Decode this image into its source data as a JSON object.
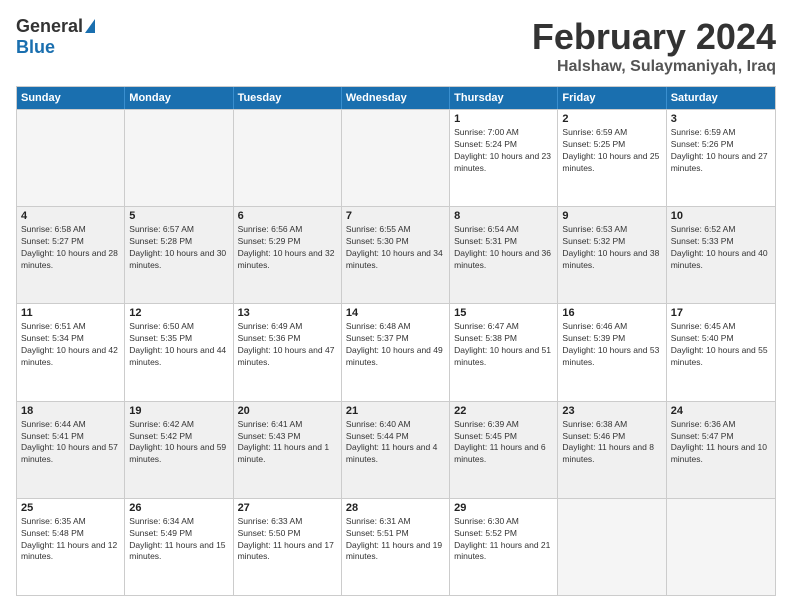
{
  "header": {
    "logo_general": "General",
    "logo_blue": "Blue",
    "month_title": "February 2024",
    "location": "Halshaw, Sulaymaniyah, Iraq"
  },
  "weekdays": [
    "Sunday",
    "Monday",
    "Tuesday",
    "Wednesday",
    "Thursday",
    "Friday",
    "Saturday"
  ],
  "rows": [
    [
      {
        "day": "",
        "empty": true
      },
      {
        "day": "",
        "empty": true
      },
      {
        "day": "",
        "empty": true
      },
      {
        "day": "",
        "empty": true
      },
      {
        "day": "1",
        "sunrise": "7:00 AM",
        "sunset": "5:24 PM",
        "daylight": "10 hours and 23 minutes."
      },
      {
        "day": "2",
        "sunrise": "6:59 AM",
        "sunset": "5:25 PM",
        "daylight": "10 hours and 25 minutes."
      },
      {
        "day": "3",
        "sunrise": "6:59 AM",
        "sunset": "5:26 PM",
        "daylight": "10 hours and 27 minutes."
      }
    ],
    [
      {
        "day": "4",
        "sunrise": "6:58 AM",
        "sunset": "5:27 PM",
        "daylight": "10 hours and 28 minutes."
      },
      {
        "day": "5",
        "sunrise": "6:57 AM",
        "sunset": "5:28 PM",
        "daylight": "10 hours and 30 minutes."
      },
      {
        "day": "6",
        "sunrise": "6:56 AM",
        "sunset": "5:29 PM",
        "daylight": "10 hours and 32 minutes."
      },
      {
        "day": "7",
        "sunrise": "6:55 AM",
        "sunset": "5:30 PM",
        "daylight": "10 hours and 34 minutes."
      },
      {
        "day": "8",
        "sunrise": "6:54 AM",
        "sunset": "5:31 PM",
        "daylight": "10 hours and 36 minutes."
      },
      {
        "day": "9",
        "sunrise": "6:53 AM",
        "sunset": "5:32 PM",
        "daylight": "10 hours and 38 minutes."
      },
      {
        "day": "10",
        "sunrise": "6:52 AM",
        "sunset": "5:33 PM",
        "daylight": "10 hours and 40 minutes."
      }
    ],
    [
      {
        "day": "11",
        "sunrise": "6:51 AM",
        "sunset": "5:34 PM",
        "daylight": "10 hours and 42 minutes."
      },
      {
        "day": "12",
        "sunrise": "6:50 AM",
        "sunset": "5:35 PM",
        "daylight": "10 hours and 44 minutes."
      },
      {
        "day": "13",
        "sunrise": "6:49 AM",
        "sunset": "5:36 PM",
        "daylight": "10 hours and 47 minutes."
      },
      {
        "day": "14",
        "sunrise": "6:48 AM",
        "sunset": "5:37 PM",
        "daylight": "10 hours and 49 minutes."
      },
      {
        "day": "15",
        "sunrise": "6:47 AM",
        "sunset": "5:38 PM",
        "daylight": "10 hours and 51 minutes."
      },
      {
        "day": "16",
        "sunrise": "6:46 AM",
        "sunset": "5:39 PM",
        "daylight": "10 hours and 53 minutes."
      },
      {
        "day": "17",
        "sunrise": "6:45 AM",
        "sunset": "5:40 PM",
        "daylight": "10 hours and 55 minutes."
      }
    ],
    [
      {
        "day": "18",
        "sunrise": "6:44 AM",
        "sunset": "5:41 PM",
        "daylight": "10 hours and 57 minutes."
      },
      {
        "day": "19",
        "sunrise": "6:42 AM",
        "sunset": "5:42 PM",
        "daylight": "10 hours and 59 minutes."
      },
      {
        "day": "20",
        "sunrise": "6:41 AM",
        "sunset": "5:43 PM",
        "daylight": "11 hours and 1 minute."
      },
      {
        "day": "21",
        "sunrise": "6:40 AM",
        "sunset": "5:44 PM",
        "daylight": "11 hours and 4 minutes."
      },
      {
        "day": "22",
        "sunrise": "6:39 AM",
        "sunset": "5:45 PM",
        "daylight": "11 hours and 6 minutes."
      },
      {
        "day": "23",
        "sunrise": "6:38 AM",
        "sunset": "5:46 PM",
        "daylight": "11 hours and 8 minutes."
      },
      {
        "day": "24",
        "sunrise": "6:36 AM",
        "sunset": "5:47 PM",
        "daylight": "11 hours and 10 minutes."
      }
    ],
    [
      {
        "day": "25",
        "sunrise": "6:35 AM",
        "sunset": "5:48 PM",
        "daylight": "11 hours and 12 minutes."
      },
      {
        "day": "26",
        "sunrise": "6:34 AM",
        "sunset": "5:49 PM",
        "daylight": "11 hours and 15 minutes."
      },
      {
        "day": "27",
        "sunrise": "6:33 AM",
        "sunset": "5:50 PM",
        "daylight": "11 hours and 17 minutes."
      },
      {
        "day": "28",
        "sunrise": "6:31 AM",
        "sunset": "5:51 PM",
        "daylight": "11 hours and 19 minutes."
      },
      {
        "day": "29",
        "sunrise": "6:30 AM",
        "sunset": "5:52 PM",
        "daylight": "11 hours and 21 minutes."
      },
      {
        "day": "",
        "empty": true
      },
      {
        "day": "",
        "empty": true
      }
    ]
  ]
}
